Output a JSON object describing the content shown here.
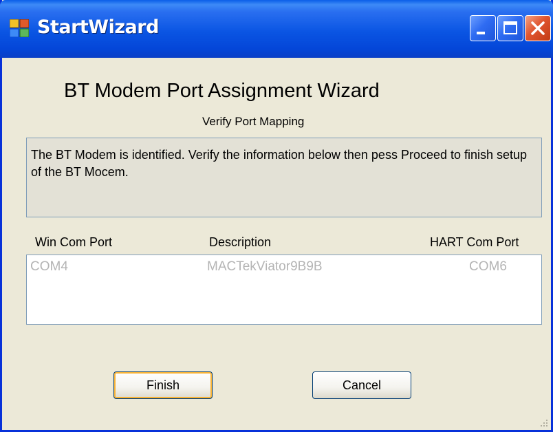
{
  "window": {
    "title": "StartWizard",
    "controls": {
      "minimize_icon": "minimize-icon",
      "maximize_icon": "maximize-icon",
      "close_icon": "close-icon"
    }
  },
  "wizard": {
    "heading": "BT Modem Port Assignment Wizard",
    "subheading": "Verify Port Mapping",
    "info_text": "The BT Modem is identified.  Verify the information below then pess Proceed to finish setup of the BT Mocem."
  },
  "port_table": {
    "headers": {
      "win_com_port": "Win Com Port",
      "description": "Description",
      "hart_com_port": "HART Com Port"
    },
    "rows": [
      {
        "win_com_port": "COM4",
        "description": "MACTekViator9B9B",
        "hart_com_port": "COM6"
      }
    ]
  },
  "buttons": {
    "finish": "Finish",
    "cancel": "Cancel"
  },
  "colors": {
    "titlebar": "#0a55e3",
    "window_face": "#ece9d8",
    "disabled_text": "#b4b4b4",
    "close_button": "#e0552f"
  }
}
